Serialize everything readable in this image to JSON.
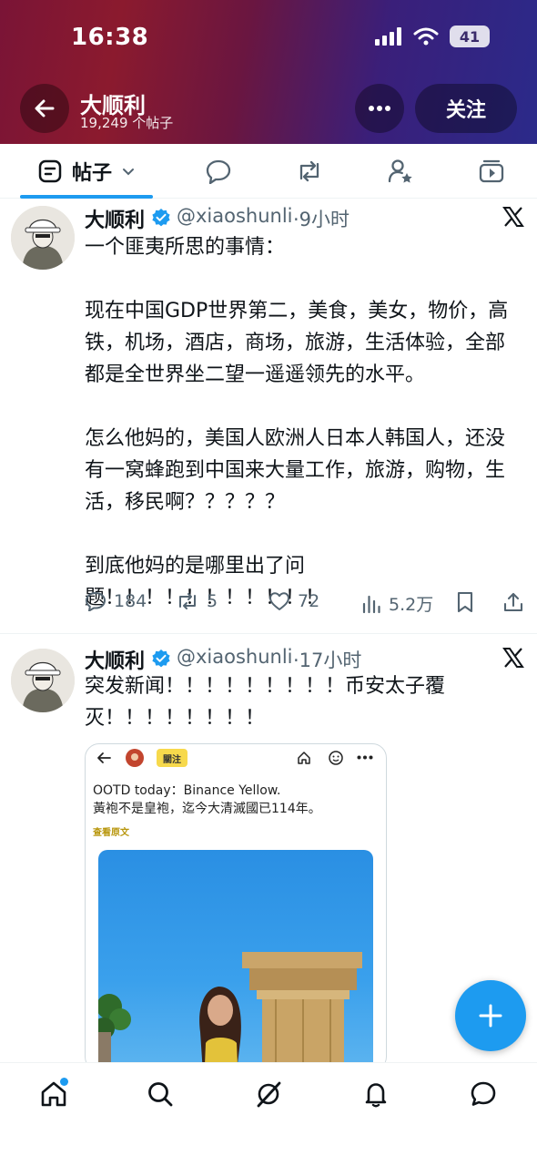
{
  "status_bar": {
    "time": "16:38",
    "battery": "41"
  },
  "header": {
    "name": "大顺利",
    "post_count": "19,249 个帖子",
    "follow_label": "关注"
  },
  "tabs": {
    "active_label": "帖子"
  },
  "posts": [
    {
      "name": "大顺利",
      "handle": "@xiaoshunli",
      "time": "·9小时",
      "text": "一个匪夷所思的事情：\n\n现在中国GDP世界第二，美食，美女，物价，高铁，机场，酒店，商场，旅游，生活体验，全部都是全世界坐二望一遥遥领先的水平。\n\n怎么他妈的，美国人欧洲人日本人韩国人，还没有一窝蜂跑到中国来大量工作，旅游，购物，生活，移民啊？？？？？\n\n到底他妈的是哪里出了问\n题！！！！！！！！！！！",
      "replies": "184",
      "reposts": "5",
      "likes": "72",
      "views": "5.2万"
    },
    {
      "name": "大顺利",
      "handle": "@xiaoshunli",
      "time": "·17小时",
      "text": "突发新闻！！！！！！！！！币安太子覆\n灭！！！！！！！！",
      "media": {
        "follow_label": "關注",
        "line1": "OOTD today：Binance Yellow.",
        "line2": "黃袍不是皇袍，迄今大清滅國已114年。",
        "link": "查看原文"
      }
    }
  ],
  "colors": {
    "accent": "#1d9bf0",
    "text": "#0f1419",
    "secondary": "#536471"
  }
}
